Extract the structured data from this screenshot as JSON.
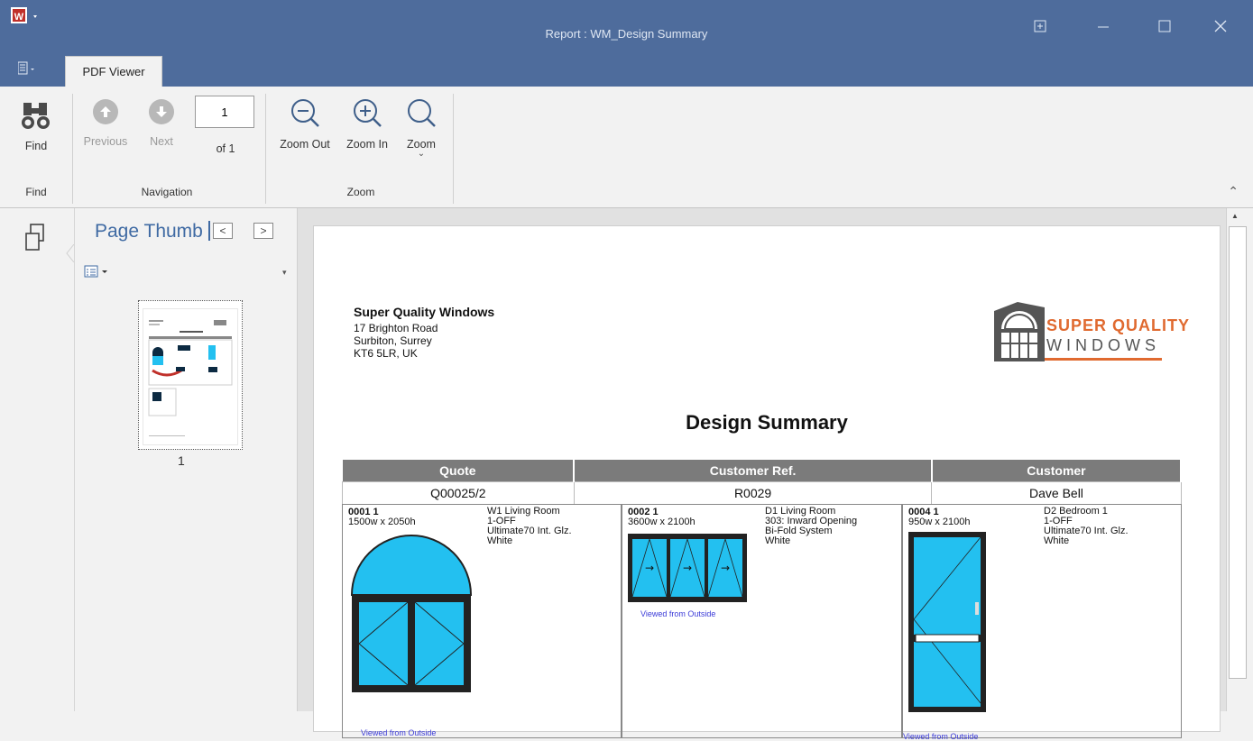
{
  "window": {
    "title": "Report : WM_Design Summary",
    "controls": [
      "restore-icon",
      "minimize-icon",
      "maximize-icon",
      "close-icon"
    ]
  },
  "ribbon": {
    "tab": "PDF Viewer",
    "find": {
      "label": "Find",
      "group": "Find"
    },
    "navigation": {
      "previous": "Previous",
      "next": "Next",
      "page_value": "1",
      "of_label": "of 1",
      "group": "Navigation"
    },
    "zoom": {
      "zoom_out": "Zoom Out",
      "zoom_in": "Zoom In",
      "zoom": "Zoom",
      "group": "Zoom"
    }
  },
  "thumbnails": {
    "title": "Page Thumb",
    "page_number": "1"
  },
  "report": {
    "company": {
      "name": "Super Quality Windows",
      "address": [
        "17 Brighton Road",
        "Surbiton, Surrey",
        "KT6 5LR, UK"
      ]
    },
    "logo": {
      "line1": "SUPER QUALITY",
      "line2": "WINDOWS"
    },
    "title": "Design Summary",
    "headers": [
      "Quote",
      "Customer Ref.",
      "Customer"
    ],
    "values": [
      "Q00025/2",
      "R0029",
      "Dave Bell"
    ],
    "items": [
      {
        "code": "0001   1",
        "size": "1500w x 2050h",
        "desc": [
          "W1  Living Room",
          "1-OFF",
          "Ultimate70 Int. Glz.",
          "White"
        ],
        "viewed": "Viewed from Outside"
      },
      {
        "code": "0002   1",
        "size": "3600w x 2100h",
        "desc": [
          "D1  Living Room",
          "303: Inward Opening",
          "Bi-Fold System",
          "White"
        ],
        "viewed": "Viewed from Outside"
      },
      {
        "code": "0004   1",
        "size": "950w x 2100h",
        "desc": [
          "D2  Bedroom 1",
          "1-OFF",
          "Ultimate70 Int. Glz.",
          "White"
        ],
        "viewed": "Viewed from Outside"
      }
    ]
  },
  "colors": {
    "titlebar": "#4e6c9c",
    "glass": "#23c0f0",
    "header_gray": "#7b7b7b",
    "accent_orange": "#e06a30"
  }
}
